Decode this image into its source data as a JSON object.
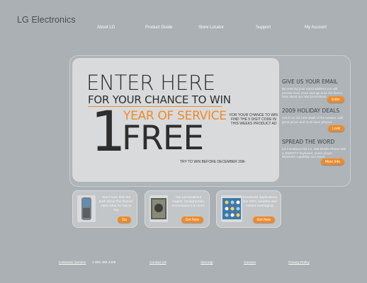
{
  "brand": {
    "logo_text": "LG Electronics"
  },
  "nav": {
    "items": [
      {
        "label": "About LG"
      },
      {
        "label": "Product Guide"
      },
      {
        "label": "Store Locator"
      },
      {
        "label": "Support"
      },
      {
        "label": "My Account"
      }
    ]
  },
  "hero": {
    "headline": "ENTER HERE",
    "subheadline": "FOR YOUR CHANCE TO WIN",
    "number": "1",
    "year_of_service": "YEAR OF SERVICE",
    "free": "FREE",
    "promo_text": "FOR YOUR CHANCE TO WIN FIND THE 5 DIGIT CODE IN THIS WEEKS PRODUCT AD",
    "deadline": "TRY TO WIN BEFORE DECEMBER 29th",
    "accent_color": "#ef8a2a"
  },
  "sidebar": [
    {
      "title": "GIVE US YOUR EMAIL",
      "body": "By entering your email address you will receive even more savings & be the first to hear about our new promotions.",
      "button": "Enter"
    },
    {
      "title": "2009 HOLIDAY DEALS",
      "body": "Get in on our best deals of the season, with great prices and must have phones.",
      "button": "Look"
    },
    {
      "title": "SPREAD THE WORD",
      "body": "LG introduces the LX, 365 Mobile Phone with a QWERTY keyboard, music player, Bluetooth capability and email.",
      "button": "More Info"
    }
  ],
  "cards": [
    {
      "text": "Text Favre tells the truth about this Rumor. Here what he has to say",
      "button": "Go",
      "thumb": "phone-thumbnail"
    },
    {
      "text": "Get personalized ringers, backgrounds, screensavers & more.",
      "button": "Get Now",
      "thumb": "wallpaper-thumbnail"
    },
    {
      "text": "Download applications like GPS, weather and instant messaging.",
      "button": "Get Now",
      "thumb": "apps-thumbnail"
    }
  ],
  "footer": {
    "links": [
      {
        "label": "Customer Service"
      },
      {
        "label": "1 800 469 4409"
      },
      {
        "label": "Contact Us"
      },
      {
        "label": "Sitemap"
      },
      {
        "label": "Careers"
      },
      {
        "label": "Privacy Policy"
      }
    ]
  }
}
